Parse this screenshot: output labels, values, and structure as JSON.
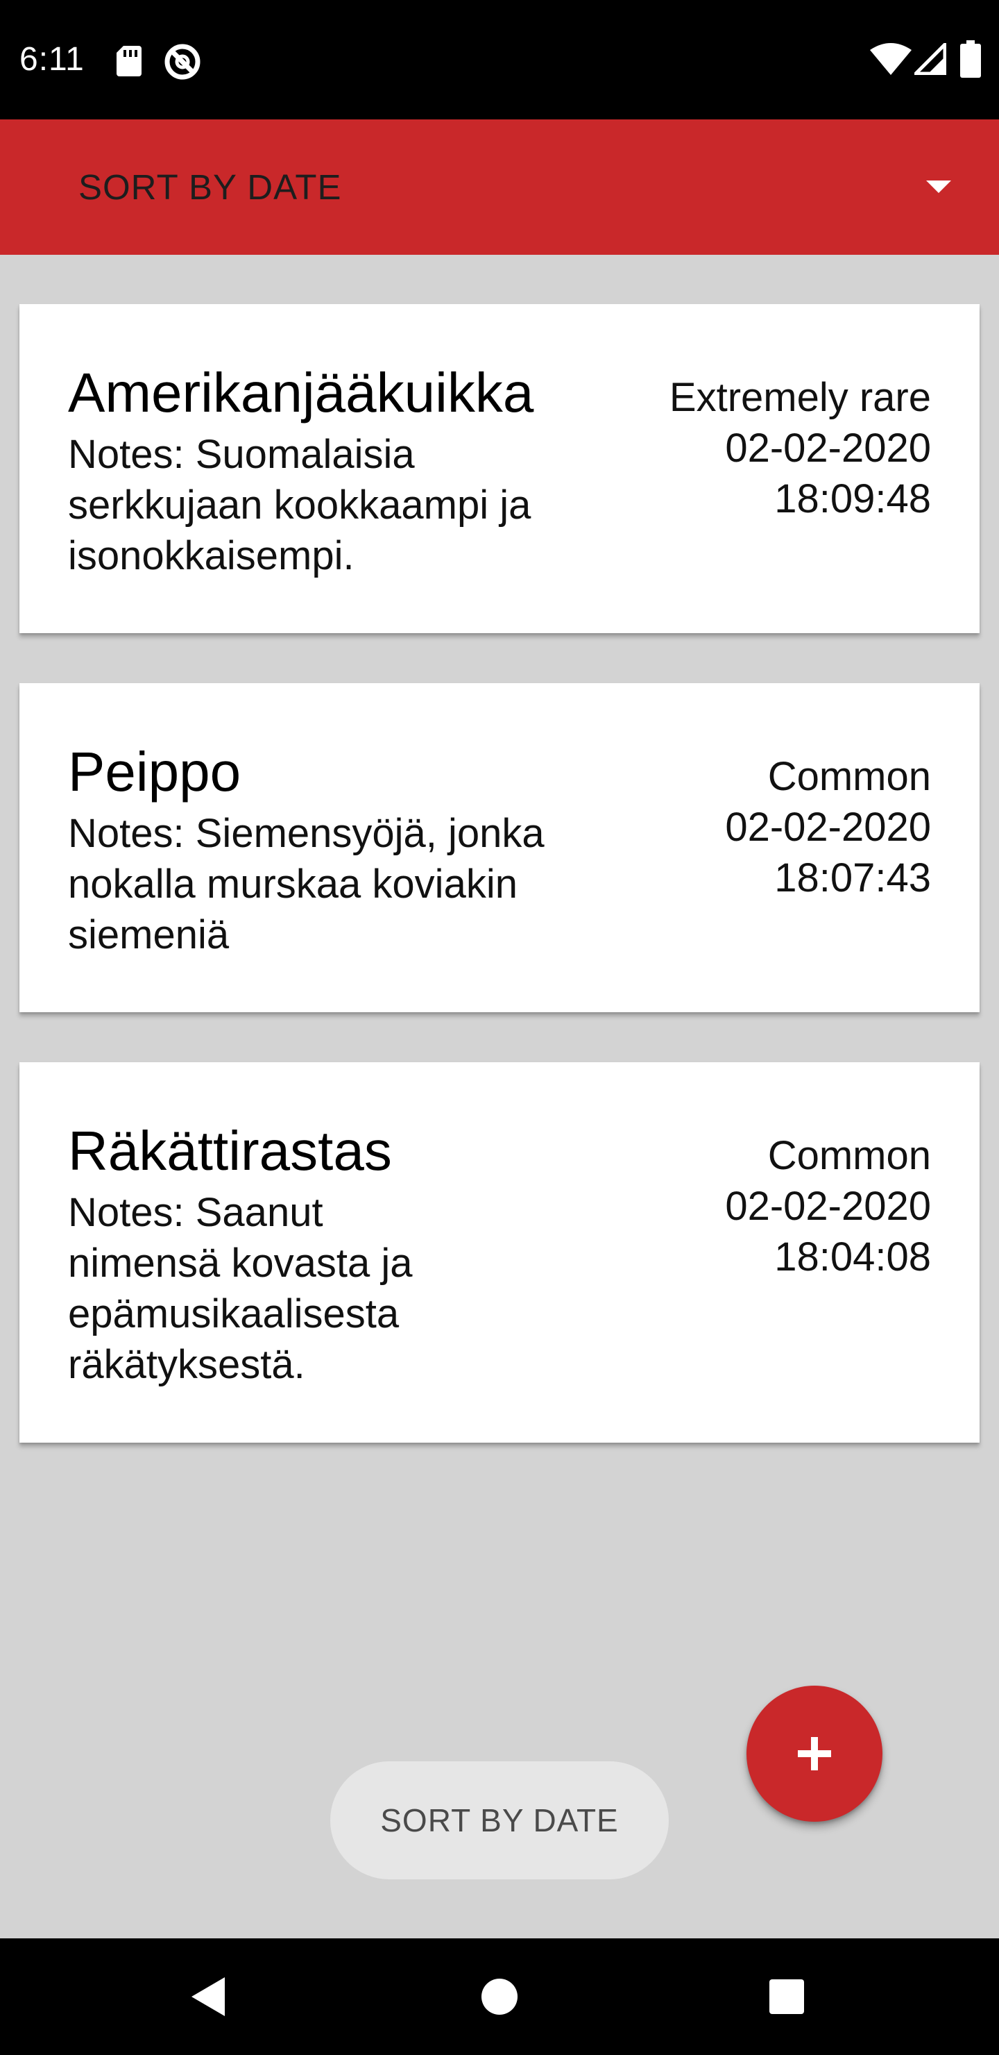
{
  "status_bar": {
    "time": "6:11",
    "icons": [
      "sd-card-icon",
      "do-not-disturb-icon",
      "wifi-icon",
      "cell-signal-icon",
      "battery-icon"
    ]
  },
  "toolbar": {
    "sort_label": "SORT BY DATE",
    "dropdown_icon": "dropdown-arrow-icon",
    "background": "#c9282a"
  },
  "observations": [
    {
      "name": "Amerikanjääkuikka",
      "notes": "Notes: Suomalaisia serkkujaan kookkaampi ja isonokkaisempi.",
      "rarity": "Extremely rare",
      "date": "02-02-2020",
      "time": "18:09:48"
    },
    {
      "name": "Peippo",
      "notes": "Notes: Siemensyöjä, jonka nokalla murskaa koviakin siemeniä",
      "rarity": "Common",
      "date": "02-02-2020",
      "time": "18:07:43"
    },
    {
      "name": "Räkättirastas",
      "notes": "Notes: Saanut nimensä kovasta ja epämusikaalisesta räkätyksestä.",
      "rarity": "Common",
      "date": "02-02-2020",
      "time": "18:04:08"
    }
  ],
  "sort_button": {
    "label": "SORT BY DATE"
  },
  "fab": {
    "icon": "plus-icon",
    "color": "#c9282a"
  },
  "nav_bar": {
    "icons": [
      "back-icon",
      "home-icon",
      "recents-icon"
    ]
  }
}
